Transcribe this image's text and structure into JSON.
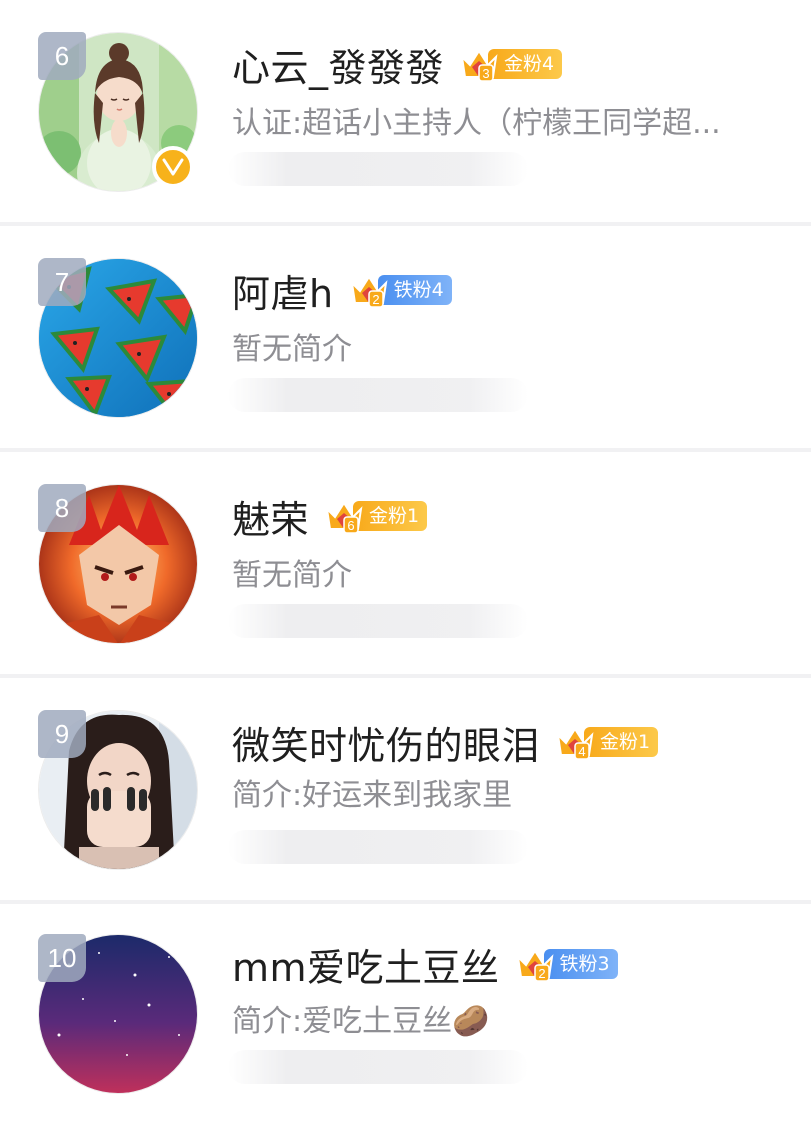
{
  "rows": [
    {
      "rank": "6",
      "username": "心云_發發發",
      "fan_level_num": "3",
      "fan_badge": "金粉4",
      "fan_type": "gold",
      "bio": "认证:超话小主持人（柠檬王同学超...",
      "verified": true,
      "avatar_icon": "girl-illustration-avatar"
    },
    {
      "rank": "7",
      "username": "阿虐h",
      "fan_level_num": "2",
      "fan_badge": "铁粉4",
      "fan_type": "iron",
      "bio": "暂无简介",
      "verified": false,
      "avatar_icon": "watermelon-avatar"
    },
    {
      "rank": "8",
      "username": "魅荣",
      "fan_level_num": "6",
      "fan_badge": "金粉1",
      "fan_type": "gold",
      "bio": "暂无简介",
      "verified": false,
      "avatar_icon": "anime-fire-avatar"
    },
    {
      "rank": "9",
      "username": "微笑时忧伤的眼泪",
      "fan_level_num": "4",
      "fan_badge": "金粉1",
      "fan_type": "gold",
      "bio": "简介:好运来到我家里",
      "verified": false,
      "avatar_icon": "woman-portrait-avatar"
    },
    {
      "rank": "10",
      "username": "mm爱吃土豆丝",
      "fan_level_num": "2",
      "fan_badge": "铁粉3",
      "fan_type": "iron",
      "bio": "简介:爱吃土豆丝🥔",
      "verified": false,
      "avatar_icon": "starry-sky-avatar"
    }
  ],
  "colors": {
    "gold": "#f8a91a",
    "iron": "#4a8ff0",
    "rank_badge": "#a0aabe",
    "verified": "#f7b21b"
  }
}
